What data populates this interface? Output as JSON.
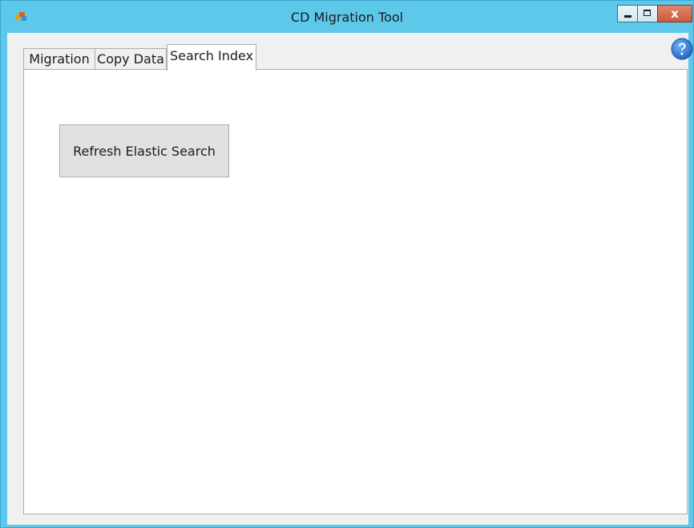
{
  "window": {
    "title": "CD Migration Tool",
    "controls": {
      "close_label": "x"
    }
  },
  "tabs": [
    {
      "label": "Migration",
      "selected": false
    },
    {
      "label": "Copy Data",
      "selected": false
    },
    {
      "label": "Search Index",
      "selected": true
    }
  ],
  "search_index": {
    "refresh_button_label": "Refresh Elastic Search"
  },
  "icons": {
    "app": "app-icon",
    "help": "help-icon",
    "minimize": "minimize-icon",
    "maximize": "maximize-icon",
    "close": "close-icon"
  },
  "colors": {
    "titlebar": "#5ec8ea",
    "client": "#f0f0f0",
    "close_button": "#c95a3f",
    "help_icon": "#1e6fd0"
  }
}
